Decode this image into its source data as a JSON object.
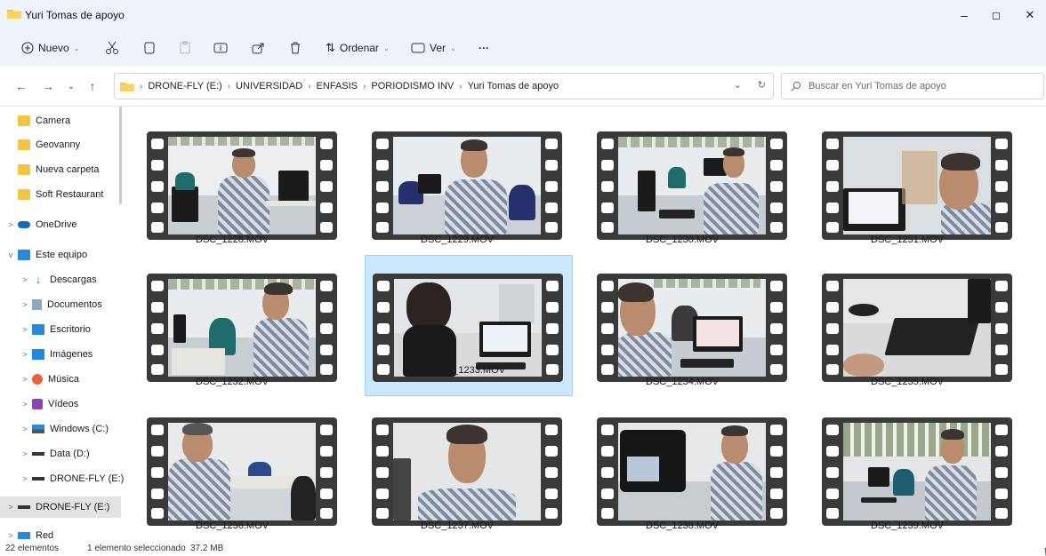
{
  "window": {
    "title": "Yuri Tomas de apoyo",
    "controls": {
      "minimize": "–",
      "maximize": "◻",
      "close": "✕"
    }
  },
  "toolbar": {
    "new_label": "Nuevo",
    "sort_label": "Ordenar",
    "view_label": "Ver",
    "more_label": "···",
    "icons": [
      "cut-icon",
      "copy-icon",
      "paste-icon",
      "rename-icon",
      "share-icon",
      "delete-icon"
    ]
  },
  "address": {
    "crumbs": [
      "DRONE-FLY (E:)",
      "UNIVERSIDAD",
      "ENFASIS",
      "PORIODISMO INV",
      "Yuri Tomas de apoyo"
    ],
    "search_placeholder": "Buscar en Yuri Tomas de apoyo"
  },
  "sidebar": {
    "items": [
      {
        "label": "Camera",
        "icon": "folder-icon",
        "expand": ""
      },
      {
        "label": "Geovanny",
        "icon": "folder-icon",
        "expand": ""
      },
      {
        "label": "Nueva carpeta",
        "icon": "folder-icon",
        "expand": ""
      },
      {
        "label": "Soft Restaurant",
        "icon": "folder-icon",
        "expand": ""
      },
      {
        "label": "OneDrive",
        "icon": "cloud-icon",
        "expand": ">"
      },
      {
        "label": "Este equipo",
        "icon": "pc-icon",
        "expand": "v"
      },
      {
        "label": "Descargas",
        "icon": "download-icon",
        "expand": ">"
      },
      {
        "label": "Documentos",
        "icon": "document-icon",
        "expand": ">"
      },
      {
        "label": "Escritorio",
        "icon": "desktop-icon",
        "expand": ">"
      },
      {
        "label": "Imágenes",
        "icon": "pictures-icon",
        "expand": ">"
      },
      {
        "label": "Música",
        "icon": "music-icon",
        "expand": ">"
      },
      {
        "label": "Vídeos",
        "icon": "videos-icon",
        "expand": ">"
      },
      {
        "label": "Windows (C:)",
        "icon": "windows-drive-icon",
        "expand": ">"
      },
      {
        "label": "Data (D:)",
        "icon": "drive-icon",
        "expand": ">"
      },
      {
        "label": "DRONE-FLY (E:)",
        "icon": "drive-icon",
        "expand": ">"
      },
      {
        "label": "DRONE-FLY (E:)",
        "icon": "drive-icon",
        "expand": ">",
        "selected": true
      },
      {
        "label": "Red",
        "icon": "network-icon",
        "expand": ">"
      }
    ]
  },
  "files": [
    {
      "name": "DSC_1228.MOV"
    },
    {
      "name": "DSC_1229.MOV"
    },
    {
      "name": "DSC_1230.MOV"
    },
    {
      "name": "DSC_1231.MOV"
    },
    {
      "name": "DSC_1232.MOV"
    },
    {
      "name": "DSC_1233.MOV",
      "selected": true
    },
    {
      "name": "DSC_1234.MOV"
    },
    {
      "name": "DSC_1235.MOV"
    },
    {
      "name": "DSC_1236.MOV"
    },
    {
      "name": "DSC_1237.MOV"
    },
    {
      "name": "DSC_1238.MOV"
    },
    {
      "name": "DSC_1239.MOV"
    }
  ],
  "status": {
    "count": "22 elementos",
    "selection": "1 elemento seleccionado",
    "size": "37.2 MB"
  },
  "colors": {
    "accent": "#0067c0",
    "selection_bg": "#cce8ff",
    "folder": "#f4c542"
  }
}
